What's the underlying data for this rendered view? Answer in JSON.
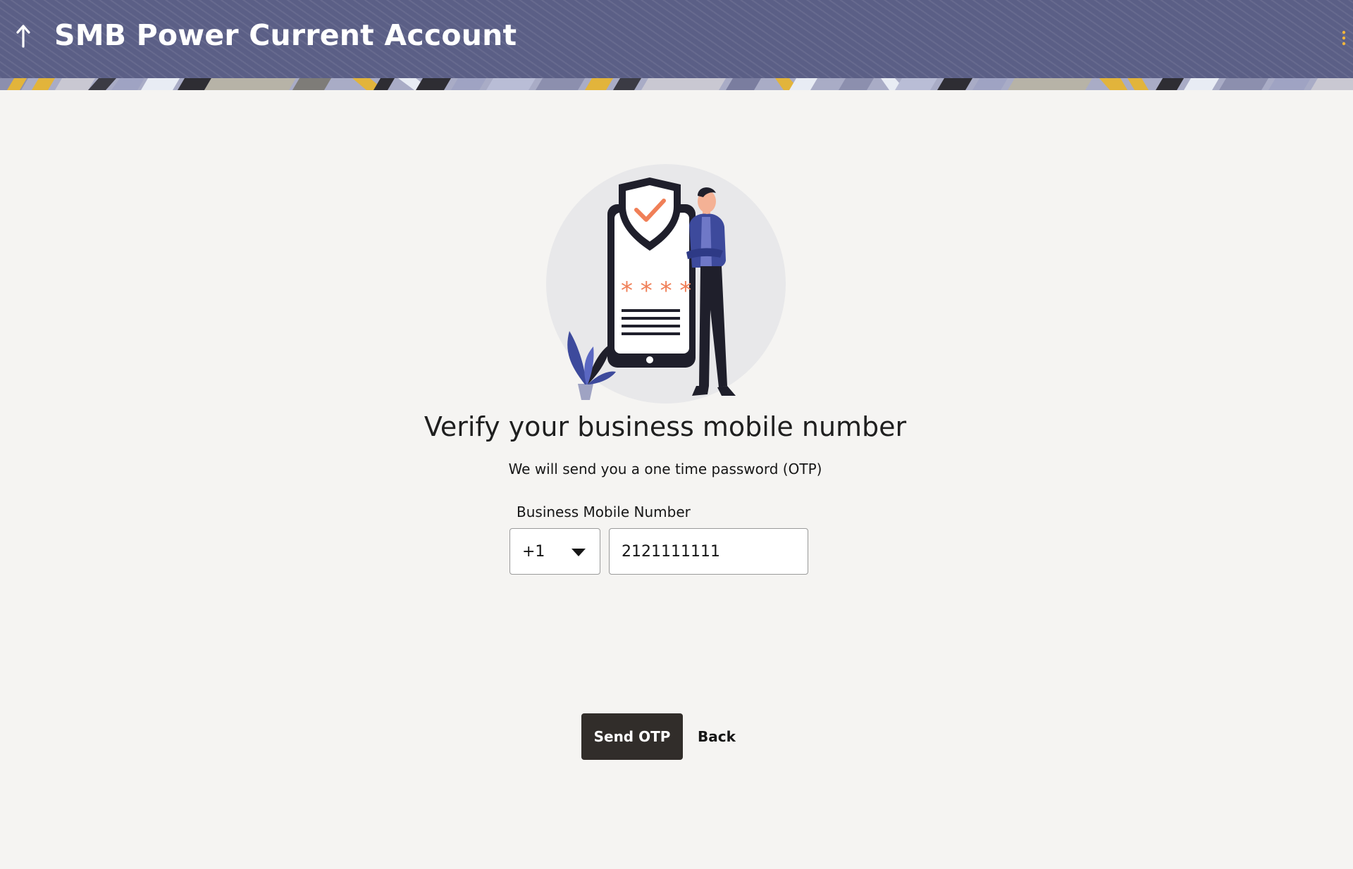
{
  "header": {
    "title": "SMB Power Current Account",
    "back_icon": "up-arrow-icon",
    "menu_icon": "kebab-menu-icon",
    "background_color": "#5b5f86",
    "menu_icon_color": "#f2b63c"
  },
  "illustration": {
    "icon": "secure-phone-verification-illustration",
    "accent_color": "#f07f57"
  },
  "main": {
    "heading": "Verify your business mobile number",
    "subheading": "We will send you a one time password (OTP)",
    "field_label": "Business Mobile Number",
    "country_code": "+1",
    "phone_value": "2121111111"
  },
  "actions": {
    "send_label": "Send OTP",
    "back_label": "Back",
    "primary_color": "#312d2a"
  }
}
